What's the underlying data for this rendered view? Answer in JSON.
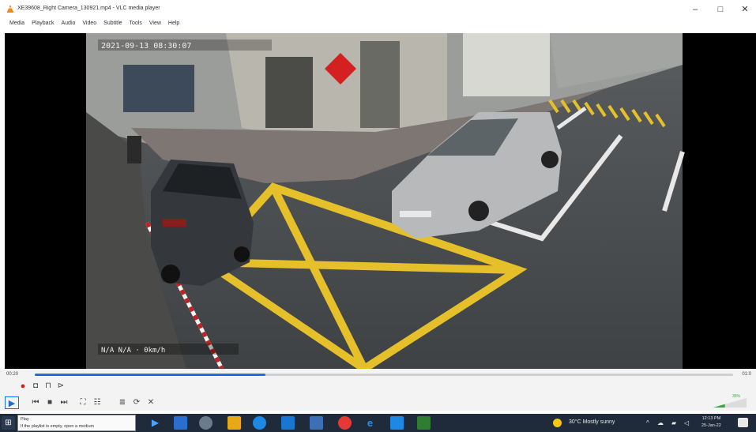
{
  "window": {
    "title": "XE39608_Right Camera_130921.mp4 - VLC media player",
    "minimize": "–",
    "maximize": "□",
    "close": "✕"
  },
  "menu": [
    "Media",
    "Playback",
    "Audio",
    "Video",
    "Subtitle",
    "Tools",
    "View",
    "Help"
  ],
  "video": {
    "timestamp_overlay": "2021-09-13 08:30:07",
    "speed_overlay": "N/A  N/A  ·  0km/h"
  },
  "player": {
    "time_elapsed": "00:20",
    "time_total": "01:0",
    "progress_fraction": 0.33,
    "volume_percent": 0.35,
    "volume_label": "35%"
  },
  "taskbar": {
    "tooltip_title": "Play",
    "tooltip_text": "If the playlist is empty, open a medium",
    "weather": "30°C  Mostly sunny",
    "time": "12:13 PM",
    "date": "25-Jan-22"
  },
  "colors": {
    "accent": "#1b6fd6",
    "road_marking": "#e6c02a",
    "taskbar": "#1f2a3a"
  }
}
